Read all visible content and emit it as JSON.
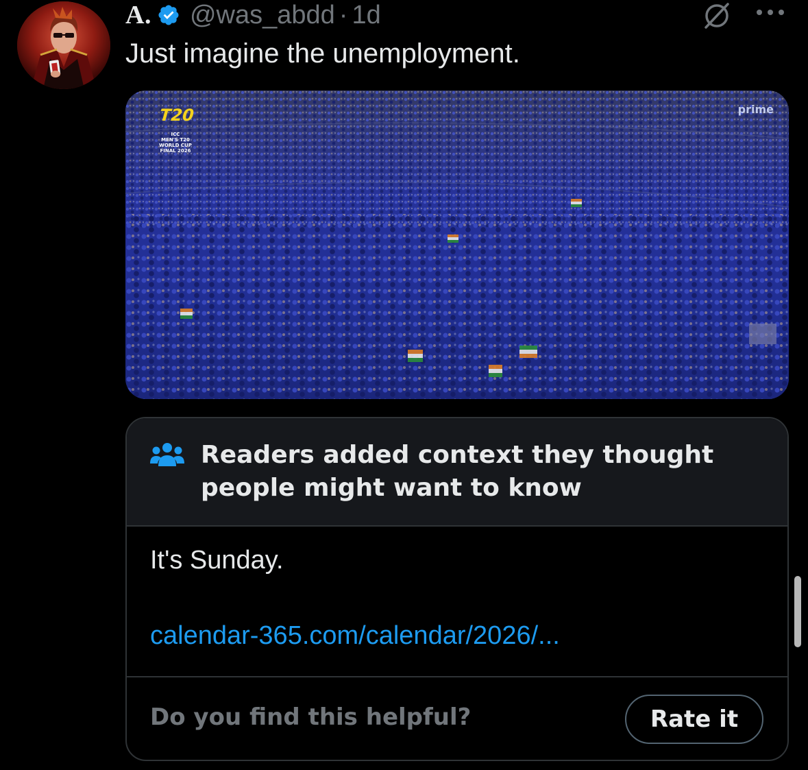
{
  "author": {
    "display_name": "A.",
    "handle": "@was_abdd",
    "separator": "·",
    "timestamp": "1d",
    "verified": true
  },
  "tweet": {
    "text": "Just imagine the unemployment."
  },
  "media": {
    "overlay_logo_lines": [
      "T20",
      "ICC",
      "MEN'S T20",
      "WORLD CUP",
      "FINAL 2026"
    ],
    "watermark": "prime"
  },
  "community_note": {
    "title": "Readers added context they thought people might want to know",
    "text": "It's Sunday.",
    "link": "calendar-365.com/calendar/2026/...",
    "helpful_question": "Do you find this helpful?",
    "rate_button": "Rate it"
  },
  "colors": {
    "background": "#000000",
    "text_primary": "#e7e9ea",
    "text_secondary": "#71767b",
    "link": "#1d9bf0",
    "verified": "#1d9bf0",
    "note_header_bg": "#16181c",
    "border": "#2f3336"
  },
  "icons": {
    "verified": "verified-badge-icon",
    "grok": "grok-icon",
    "more": "more-icon",
    "note": "people-icon"
  }
}
